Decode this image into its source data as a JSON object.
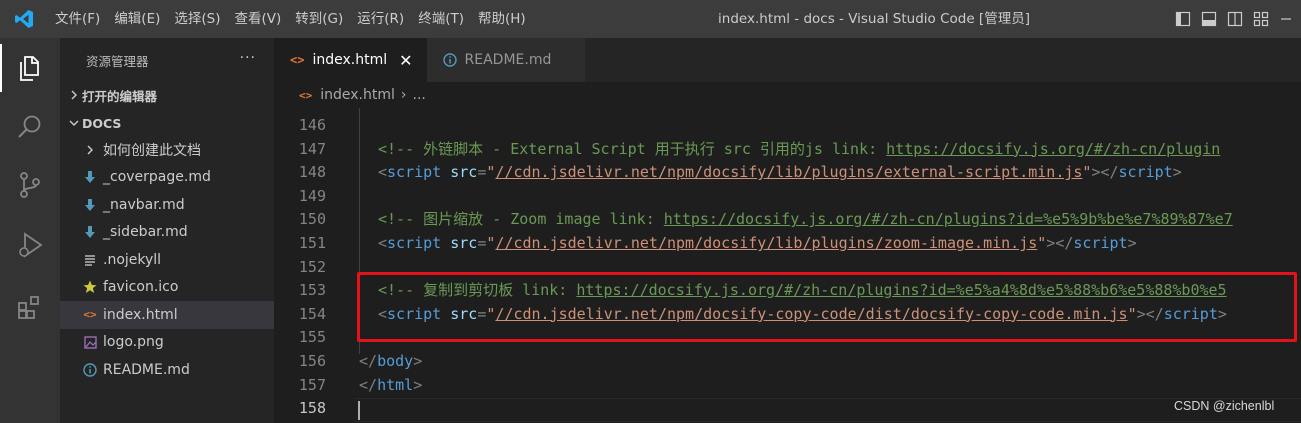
{
  "menu": [
    "文件(F)",
    "编辑(E)",
    "选择(S)",
    "查看(V)",
    "转到(G)",
    "运行(R)",
    "终端(T)",
    "帮助(H)"
  ],
  "window_title": "index.html - docs - Visual Studio Code [管理员]",
  "sidebar": {
    "title": "资源管理器",
    "more": "···",
    "open_editors": "打开的编辑器",
    "workspace": "DOCS",
    "items": [
      {
        "label": "如何创建此文档",
        "icon": "chevron-right-icon"
      },
      {
        "label": "_coverpage.md",
        "icon": "markdown-icon"
      },
      {
        "label": "_navbar.md",
        "icon": "markdown-icon"
      },
      {
        "label": "_sidebar.md",
        "icon": "markdown-icon"
      },
      {
        "label": ".nojekyll",
        "icon": "text-file-icon"
      },
      {
        "label": "favicon.ico",
        "icon": "star-icon"
      },
      {
        "label": "index.html",
        "icon": "html-icon"
      },
      {
        "label": "logo.png",
        "icon": "image-icon"
      },
      {
        "label": "README.md",
        "icon": "info-icon"
      }
    ]
  },
  "tabs": [
    {
      "label": "index.html",
      "active": true
    },
    {
      "label": "README.md",
      "active": false
    }
  ],
  "breadcrumb": {
    "file": "index.html",
    "rest": "..."
  },
  "code": {
    "lines": [
      {
        "n": "146",
        "kind": "blank"
      },
      {
        "n": "147",
        "kind": "comment",
        "pre": "<!-- 外链脚本 - External Script 用于执行 src 引用的js link: ",
        "url": "https://docsify.js.org/#/zh-cn/plugin"
      },
      {
        "n": "148",
        "kind": "script",
        "src": "//cdn.jsdelivr.net/npm/docsify/lib/plugins/external-script.min.js"
      },
      {
        "n": "149",
        "kind": "blank"
      },
      {
        "n": "150",
        "kind": "comment",
        "pre": "<!-- 图片缩放 - Zoom image link: ",
        "url": "https://docsify.js.org/#/zh-cn/plugins?id=%e5%9b%be%e7%89%87%e7"
      },
      {
        "n": "151",
        "kind": "script",
        "src": "//cdn.jsdelivr.net/npm/docsify/lib/plugins/zoom-image.min.js"
      },
      {
        "n": "152",
        "kind": "blank"
      },
      {
        "n": "153",
        "kind": "comment",
        "pre": "<!-- 复制到剪切板 link: ",
        "url": "https://docsify.js.org/#/zh-cn/plugins?id=%e5%a4%8d%e5%88%b6%e5%88%b0%e5"
      },
      {
        "n": "154",
        "kind": "script",
        "src": "//cdn.jsdelivr.net/npm/docsify-copy-code/dist/docsify-copy-code.min.js"
      },
      {
        "n": "155",
        "kind": "blank"
      },
      {
        "n": "156",
        "kind": "close",
        "tag": "body"
      },
      {
        "n": "157",
        "kind": "close",
        "tag": "html"
      },
      {
        "n": "158",
        "kind": "blank"
      }
    ],
    "current_line": "158"
  },
  "watermark": "CSDN @zichenlbl",
  "colors": {
    "highlight_box": "#e3121b",
    "accent": "#007acc"
  }
}
